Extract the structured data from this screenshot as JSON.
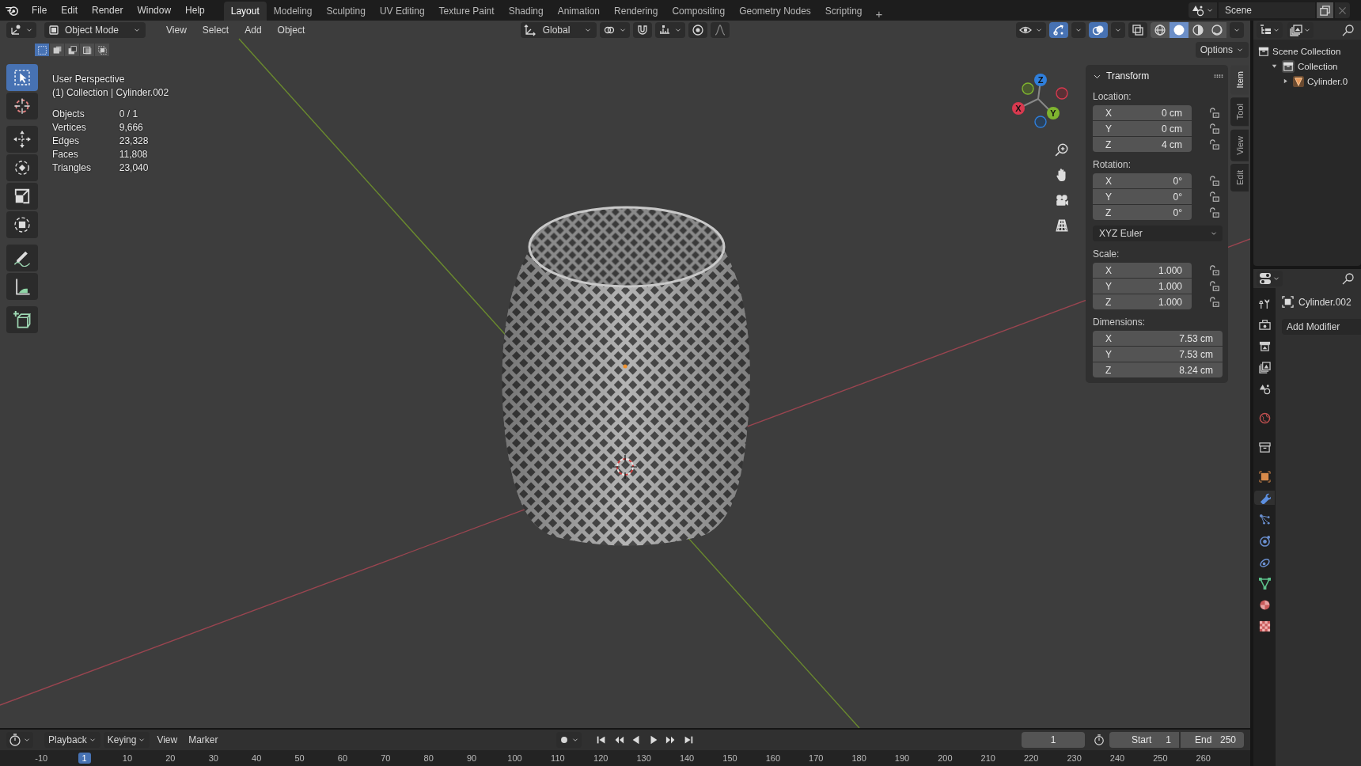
{
  "topbar": {
    "menus": [
      "File",
      "Edit",
      "Render",
      "Window",
      "Help"
    ],
    "workspaces": [
      {
        "label": "Layout",
        "selected": true
      },
      {
        "label": "Modeling",
        "selected": false
      },
      {
        "label": "Sculpting",
        "selected": false
      },
      {
        "label": "UV Editing",
        "selected": false
      },
      {
        "label": "Texture Paint",
        "selected": false
      },
      {
        "label": "Shading",
        "selected": false
      },
      {
        "label": "Animation",
        "selected": false
      },
      {
        "label": "Rendering",
        "selected": false
      },
      {
        "label": "Compositing",
        "selected": false
      },
      {
        "label": "Geometry Nodes",
        "selected": false
      },
      {
        "label": "Scripting",
        "selected": false
      }
    ],
    "add_workspace": "+",
    "scene": "Scene"
  },
  "viewport": {
    "header": {
      "mode": "Object Mode",
      "menus": [
        "View",
        "Select",
        "Add",
        "Object"
      ],
      "orientation": "Global",
      "toggles": [
        {
          "kind": "gizmo",
          "on": true
        },
        {
          "kind": "overlay",
          "on": true
        },
        {
          "kind": "xray",
          "on": false
        }
      ],
      "shading": [
        {
          "kind": "wireframe",
          "selected": false
        },
        {
          "kind": "solid",
          "selected": true
        },
        {
          "kind": "material",
          "selected": false
        },
        {
          "kind": "rendered",
          "selected": false
        }
      ]
    },
    "select_modes": [
      {
        "kind": "set",
        "selected": true
      },
      {
        "kind": "extend",
        "selected": false
      },
      {
        "kind": "subtract",
        "selected": false
      },
      {
        "kind": "invert",
        "selected": false
      },
      {
        "kind": "intersect",
        "selected": false
      }
    ],
    "options": "Options",
    "tools": [
      {
        "kind": "select",
        "selected": true
      },
      {
        "kind": "cursor",
        "selected": false
      },
      {
        "kind": "move",
        "selected": false
      },
      {
        "kind": "rotate",
        "selected": false
      },
      {
        "kind": "scale",
        "selected": false
      },
      {
        "kind": "transform",
        "selected": false
      },
      {
        "kind": "annotate",
        "selected": false
      },
      {
        "kind": "measure",
        "selected": false
      },
      {
        "kind": "add_cube",
        "selected": false
      }
    ],
    "view_name": "User Perspective",
    "context": "(1) Collection | Cylinder.002",
    "stats": [
      {
        "label": "Objects",
        "value": "0 / 1"
      },
      {
        "label": "Vertices",
        "value": "9,666"
      },
      {
        "label": "Edges",
        "value": "23,328"
      },
      {
        "label": "Faces",
        "value": "11,808"
      },
      {
        "label": "Triangles",
        "value": "23,040"
      }
    ],
    "gizmo": [
      {
        "label": "Z",
        "color": "#2f7fdc"
      },
      {
        "label": "Y",
        "color": "#7fb52f"
      },
      {
        "label": "X",
        "color": "#d8394f"
      }
    ]
  },
  "sidebar": {
    "tabs": [
      {
        "label": "Item",
        "selected": true
      },
      {
        "label": "Tool",
        "selected": false
      },
      {
        "label": "View",
        "selected": false
      },
      {
        "label": "Edit",
        "selected": false
      }
    ],
    "panel": {
      "title": "Transform",
      "expanded": true,
      "groups": [
        {
          "kind": "vector",
          "label": "Location:",
          "lock": true,
          "fields": [
            {
              "axis": "X",
              "value": "0 cm"
            },
            {
              "axis": "Y",
              "value": "0 cm"
            },
            {
              "axis": "Z",
              "value": "4 cm"
            }
          ]
        },
        {
          "kind": "vector",
          "label": "Rotation:",
          "lock": true,
          "fields": [
            {
              "axis": "X",
              "value": "0°"
            },
            {
              "axis": "Y",
              "value": "0°"
            },
            {
              "axis": "Z",
              "value": "0°"
            }
          ]
        },
        {
          "kind": "dropdown",
          "value": "XYZ Euler"
        },
        {
          "kind": "vector",
          "label": "Scale:",
          "lock": true,
          "fields": [
            {
              "axis": "X",
              "value": "1.000"
            },
            {
              "axis": "Y",
              "value": "1.000"
            },
            {
              "axis": "Z",
              "value": "1.000"
            }
          ]
        },
        {
          "kind": "vector",
          "label": "Dimensions:",
          "lock": false,
          "fields": [
            {
              "axis": "X",
              "value": "7.53 cm"
            },
            {
              "axis": "Y",
              "value": "7.53 cm"
            },
            {
              "axis": "Z",
              "value": "8.24 cm"
            }
          ]
        }
      ]
    }
  },
  "outliner": {
    "tree": [
      {
        "label": "Scene Collection",
        "kind": "scene_collection",
        "children": [
          {
            "label": "Collection",
            "kind": "collection",
            "expanded": true,
            "children": [
              {
                "label": "Cylinder.0",
                "kind": "mesh",
                "expanded": false
              }
            ]
          }
        ]
      }
    ]
  },
  "properties": {
    "tabs": [
      {
        "kind": "tool",
        "selected": false
      },
      {
        "kind": "render",
        "selected": false
      },
      {
        "kind": "output",
        "selected": false
      },
      {
        "kind": "view_layer",
        "selected": false
      },
      {
        "kind": "scene",
        "selected": false
      },
      {
        "kind": "world",
        "selected": false
      },
      {
        "kind": "collection",
        "selected": false
      },
      {
        "kind": "object",
        "selected": false
      },
      {
        "kind": "modifiers",
        "selected": true
      },
      {
        "kind": "particles",
        "selected": false
      },
      {
        "kind": "physics",
        "selected": false
      },
      {
        "kind": "constraints",
        "selected": false
      },
      {
        "kind": "data",
        "selected": false
      },
      {
        "kind": "material",
        "selected": false
      },
      {
        "kind": "texture",
        "selected": false
      }
    ],
    "object_name": "Cylinder.002",
    "add_modifier": "Add Modifier"
  },
  "timeline": {
    "menus": [
      {
        "label": "Playback",
        "dropdown": true
      },
      {
        "label": "Keying",
        "dropdown": true
      },
      {
        "label": "View",
        "dropdown": false
      },
      {
        "label": "Marker",
        "dropdown": false
      }
    ],
    "auto_keying": {
      "on": false
    },
    "current_frame": "1",
    "start": {
      "label": "Start",
      "value": "1"
    },
    "end": {
      "label": "End",
      "value": "250"
    },
    "ruler": [
      {
        "label": "-10",
        "selected": false
      },
      {
        "label": "1",
        "selected": true
      },
      {
        "label": "10",
        "selected": false
      },
      {
        "label": "20",
        "selected": false
      },
      {
        "label": "30",
        "selected": false
      },
      {
        "label": "40",
        "selected": false
      },
      {
        "label": "50",
        "selected": false
      },
      {
        "label": "60",
        "selected": false
      },
      {
        "label": "70",
        "selected": false
      },
      {
        "label": "80",
        "selected": false
      },
      {
        "label": "90",
        "selected": false
      },
      {
        "label": "100",
        "selected": false
      },
      {
        "label": "110",
        "selected": false
      },
      {
        "label": "120",
        "selected": false
      },
      {
        "label": "130",
        "selected": false
      },
      {
        "label": "140",
        "selected": false
      },
      {
        "label": "150",
        "selected": false
      },
      {
        "label": "160",
        "selected": false
      },
      {
        "label": "170",
        "selected": false
      },
      {
        "label": "180",
        "selected": false
      },
      {
        "label": "190",
        "selected": false
      },
      {
        "label": "200",
        "selected": false
      },
      {
        "label": "210",
        "selected": false
      },
      {
        "label": "220",
        "selected": false
      },
      {
        "label": "230",
        "selected": false
      },
      {
        "label": "240",
        "selected": false
      },
      {
        "label": "250",
        "selected": false
      },
      {
        "label": "260",
        "selected": false
      }
    ]
  }
}
